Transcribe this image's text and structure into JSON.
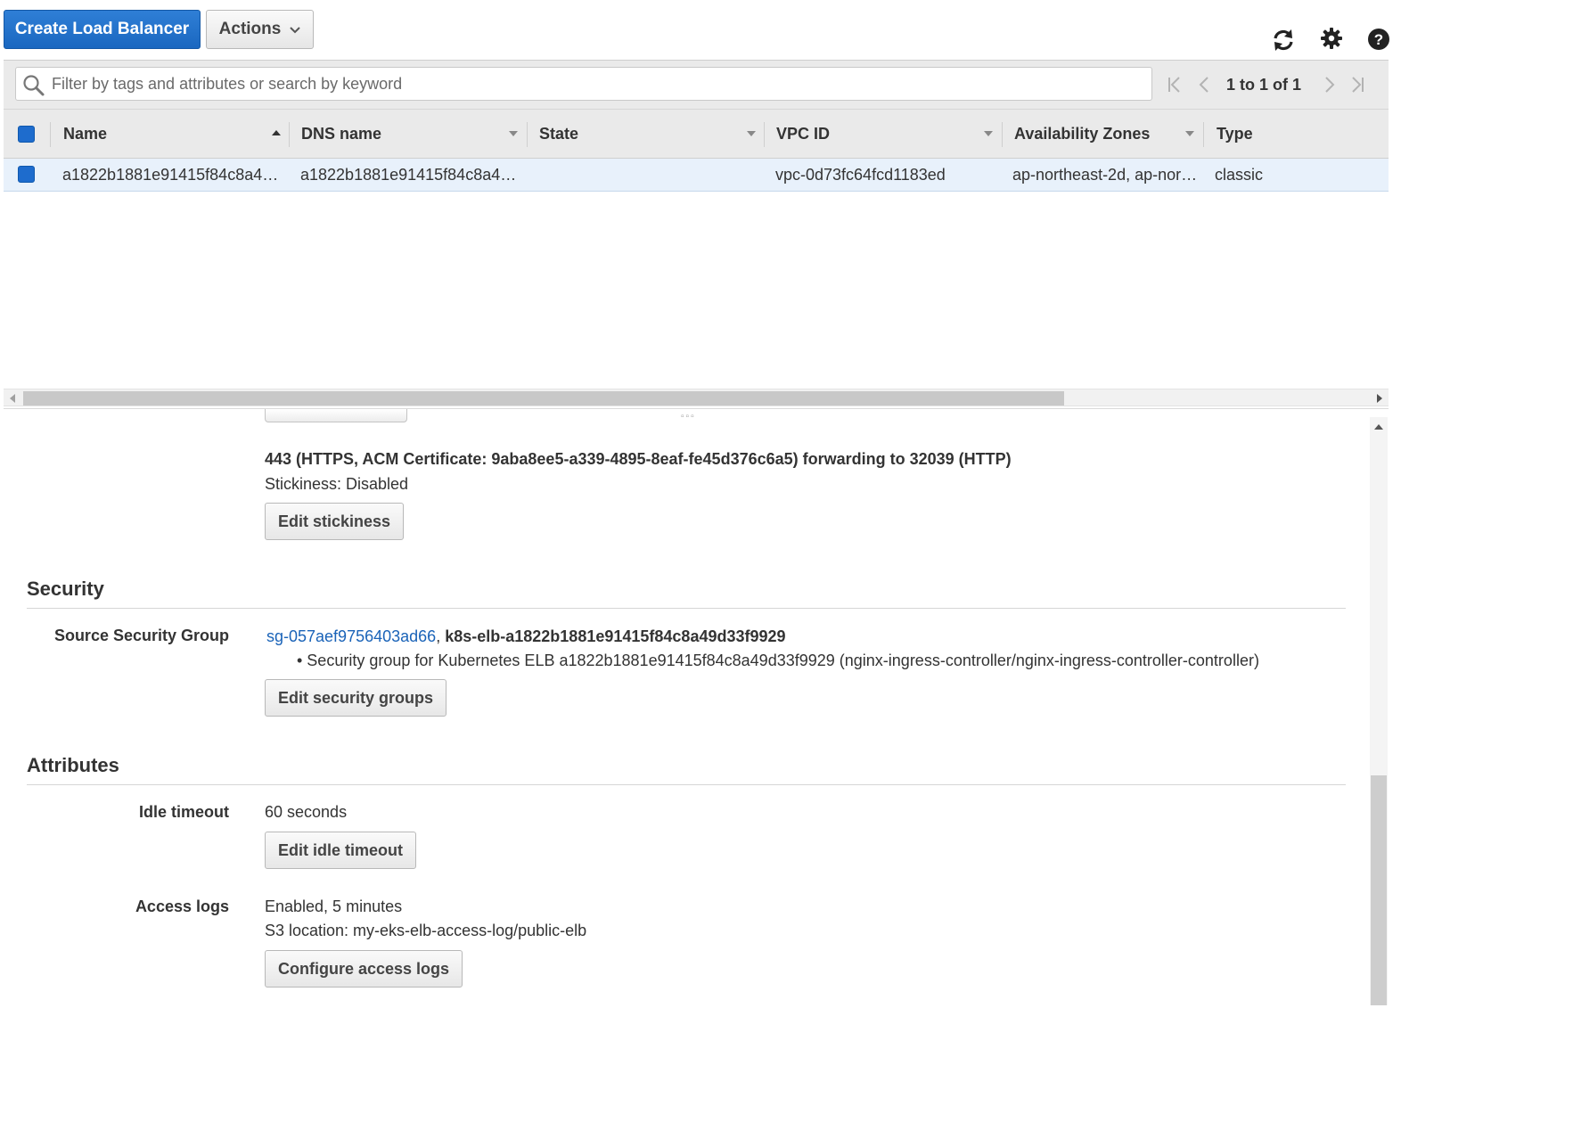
{
  "toolbar": {
    "create_label": "Create Load Balancer",
    "actions_label": "Actions",
    "icons": [
      "refresh-icon",
      "gear-icon",
      "help-icon"
    ]
  },
  "filter": {
    "placeholder": "Filter by tags and attributes or search by keyword",
    "pager_text": "1 to 1 of 1"
  },
  "table": {
    "columns": [
      "Name",
      "DNS name",
      "State",
      "VPC ID",
      "Availability Zones",
      "Type"
    ],
    "rows": [
      {
        "name": "a1822b1881e91415f84c8a4…",
        "dns_name": "a1822b1881e91415f84c8a4…",
        "state": "",
        "vpc_id": "vpc-0d73fc64fcd1183ed",
        "availability_zones": "ap-northeast-2d, ap-nor…",
        "type": "classic"
      }
    ]
  },
  "details": {
    "listener": {
      "description": "443 (HTTPS, ACM Certificate: 9aba8ee5-a339-4895-8eaf-fe45d376c6a5) forwarding to 32039 (HTTP)",
      "stickiness": "Stickiness: Disabled",
      "edit_stickiness_label": "Edit stickiness"
    },
    "security": {
      "title": "Security",
      "source_sg_label": "Source Security Group",
      "sg_id": "sg-057aef9756403ad66",
      "sg_separator": ",",
      "sg_name": "k8s-elb-a1822b1881e91415f84c8a49d33f9929",
      "sg_description": "• Security group for Kubernetes ELB a1822b1881e91415f84c8a49d33f9929 (nginx-ingress-controller/nginx-ingress-controller-controller)",
      "edit_sg_label": "Edit security groups"
    },
    "attributes": {
      "title": "Attributes",
      "idle_timeout_label": "Idle timeout",
      "idle_timeout_value": "60 seconds",
      "edit_idle_label": "Edit idle timeout",
      "access_logs_label": "Access logs",
      "access_logs_value": "Enabled, 5 minutes",
      "access_logs_location": "S3 location: my-eks-elb-access-log/public-elb",
      "configure_logs_label": "Configure access logs"
    }
  }
}
